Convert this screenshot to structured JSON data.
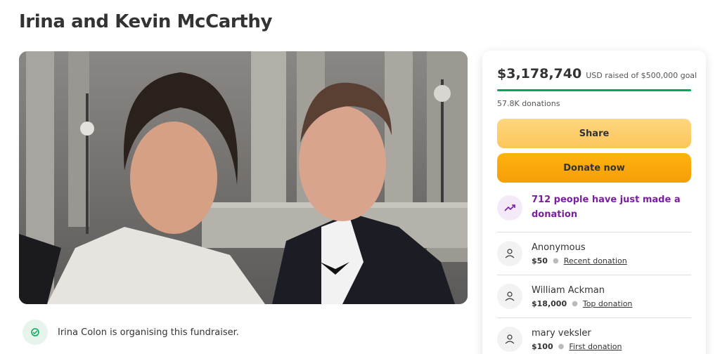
{
  "page": {
    "title": "Irina and Kevin McCarthy"
  },
  "organiser": {
    "text": "Irina Colon is organising this fundraiser."
  },
  "summary": {
    "amount": "$3,178,740",
    "goal_text": "USD raised of $500,000 goal",
    "progress_fraction": 1.0,
    "donations_count": "57.8K donations"
  },
  "buttons": {
    "share": "Share",
    "donate": "Donate now"
  },
  "activity": {
    "text": "712 people have just made a donation"
  },
  "donors": [
    {
      "name": "Anonymous",
      "amount": "$50",
      "type": "Recent donation"
    },
    {
      "name": "William Ackman",
      "amount": "$18,000",
      "type": "Top donation"
    },
    {
      "name": "mary veksler",
      "amount": "$100",
      "type": "First donation"
    }
  ],
  "colors": {
    "accent_green": "#02a95c",
    "share_yellow": "#fdcf6b",
    "donate_orange": "#f9a90c",
    "trend_purple": "#7a1fa2"
  },
  "icons": {
    "organiser": "hand-heart-icon",
    "trend": "trending-up-icon",
    "donor": "hand-heart-icon"
  }
}
